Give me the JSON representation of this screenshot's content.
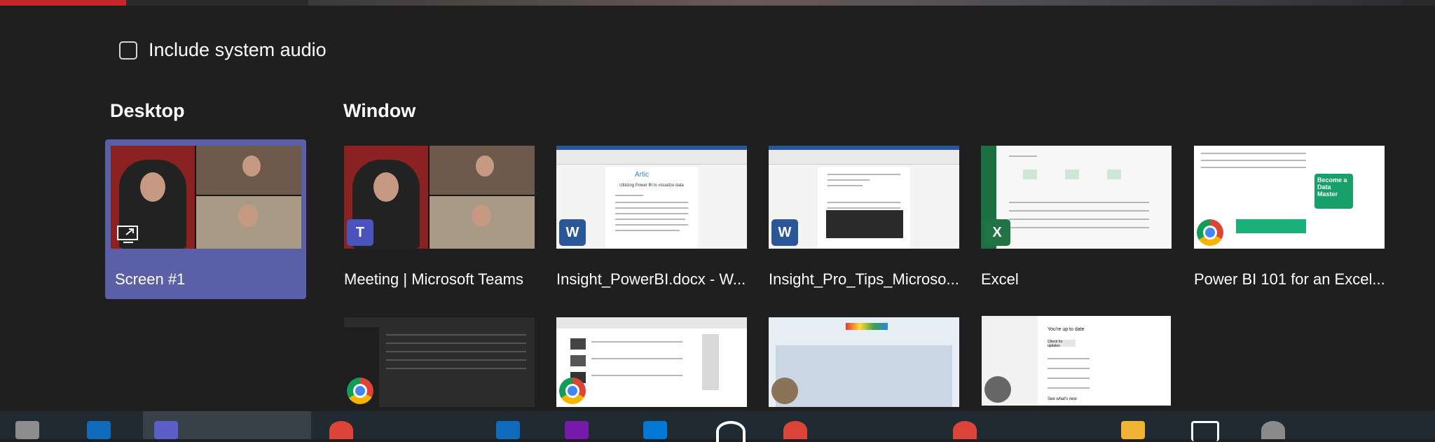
{
  "options": {
    "include_system_audio": {
      "label": "Include system audio",
      "checked": false
    }
  },
  "sections": {
    "desktop": "Desktop",
    "window": "Window"
  },
  "desktop_items": [
    {
      "label": "Screen #1",
      "selected": true,
      "icon": "share-screen-icon"
    }
  ],
  "window_items": [
    {
      "label": "Meeting | Microsoft Teams",
      "app_icon": "teams-icon"
    },
    {
      "label": "Insight_PowerBI.docx - W...",
      "app_icon": "word-icon",
      "doc_heading": "Artic",
      "doc_subheading": "Utilizing Power BI to visualize data"
    },
    {
      "label": "Insight_Pro_Tips_Microso...",
      "app_icon": "word-icon"
    },
    {
      "label": "Excel",
      "app_icon": "excel-icon"
    },
    {
      "label": "Power BI 101 for an Excel...",
      "app_icon": "chrome-icon",
      "ad_text": "Become a Data Master"
    },
    {
      "label": "",
      "app_icon": "chrome-icon"
    },
    {
      "label": "",
      "app_icon": "chrome-icon"
    },
    {
      "label": "",
      "app_icon": "paint-icon"
    },
    {
      "label": "",
      "app_icon": "settings-icon",
      "settings_texts": [
        "You're up to date",
        "Check for updates",
        "See what's new"
      ]
    }
  ],
  "badges": {
    "word": "W",
    "excel": "X",
    "teams": "T"
  },
  "colors": {
    "background": "#1f1f1f",
    "selected": "#5b5fa8",
    "taskbar": "#202a33"
  },
  "taskbar_icons": [
    "file-explorer-icon",
    "outlook-icon",
    "teams-icon",
    "chrome-icon",
    "mail-icon",
    "onenote-icon",
    "vscode-icon",
    "obs-icon",
    "chrome-icon",
    "chrome-icon",
    "folder-icon",
    "snip-icon",
    "settings-icon"
  ]
}
